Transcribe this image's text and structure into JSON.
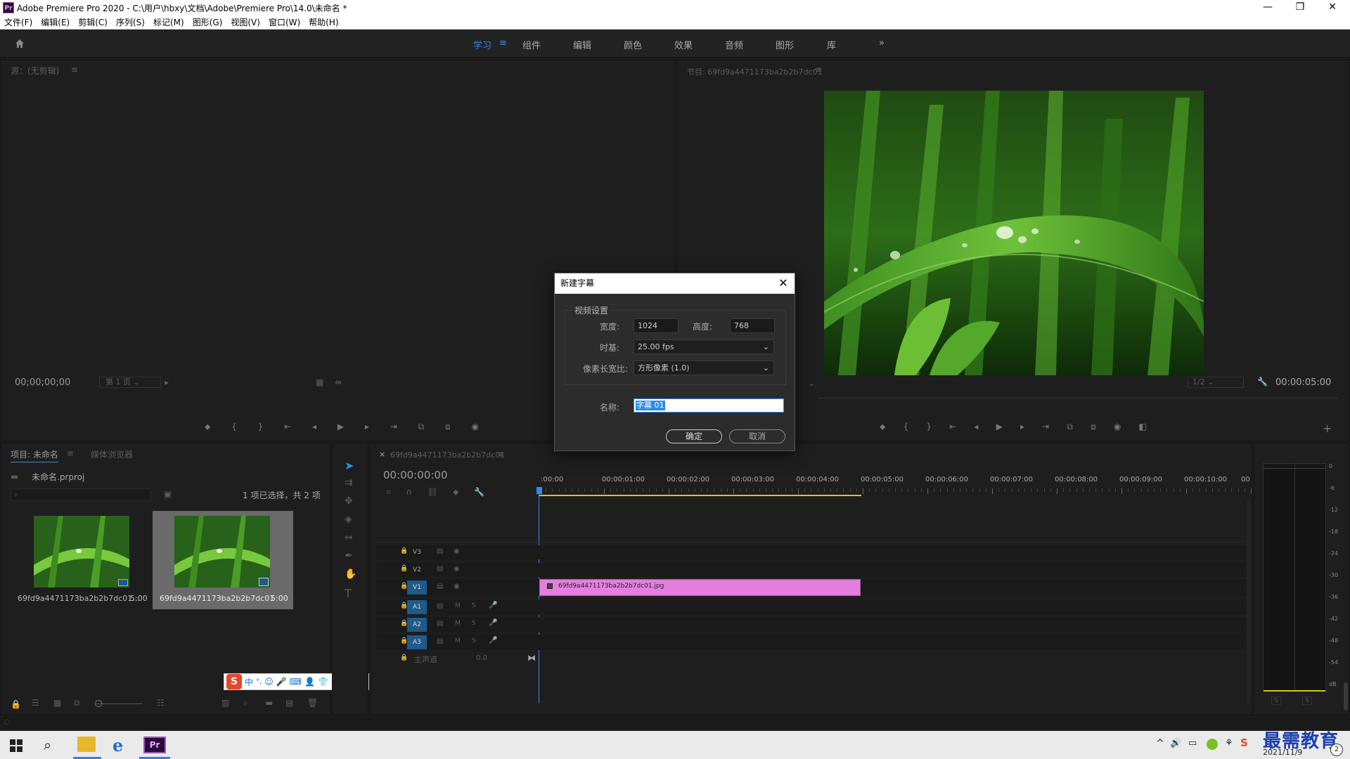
{
  "window": {
    "title": "Adobe Premiere Pro 2020 - C:\\用户\\hbxy\\文档\\Adobe\\Premiere Pro\\14.0\\未命名 *",
    "app_icon": "Pr",
    "controls": [
      "—",
      "❐",
      "✕"
    ]
  },
  "menu": [
    "文件(F)",
    "编辑(E)",
    "剪辑(C)",
    "序列(S)",
    "标记(M)",
    "图形(G)",
    "视图(V)",
    "窗口(W)",
    "帮助(H)"
  ],
  "workspaces": {
    "items": [
      "学习",
      "组件",
      "编辑",
      "颜色",
      "效果",
      "音频",
      "图形",
      "库"
    ],
    "active": "学习",
    "menu_glyph": "≡",
    "more_glyph": "»"
  },
  "source_monitor": {
    "title": "源：(无剪辑)",
    "timecode": "00;00;00;00",
    "page_select": "第 1 页"
  },
  "program_monitor": {
    "title": "节目: 69fd9a4471173ba2b2b7dc01",
    "timecode": "00:00:05:00",
    "zoom": "1/2"
  },
  "project_panel": {
    "tabs": [
      "项目: 未命名",
      "媒体浏览器"
    ],
    "project_file": "未命名.prproj",
    "selection_status": "1 项已选择，共 2 项",
    "items": [
      {
        "name": "69fd9a4471173ba2b2b7dc01...",
        "duration": "5:00"
      },
      {
        "name": "69fd9a4471173ba2b2b7dc01",
        "duration": "5:00"
      }
    ]
  },
  "timeline": {
    "sequence_name": "69fd9a4471173ba2b2b7dc01",
    "timecode": "00:00:00:00",
    "ruler": [
      ":00:00",
      "00:00:01:00",
      "00:00:02:00",
      "00:00:03:00",
      "00:00:04:00",
      "00:00:05:00",
      "00:00:06:00",
      "00:00:07:00",
      "00:00:08:00",
      "00:00:09:00",
      "00:00:10:00",
      "00"
    ],
    "video_tracks": [
      "V3",
      "V2",
      "V1"
    ],
    "audio_tracks": [
      "A1",
      "A2",
      "A3"
    ],
    "master": {
      "label": "主声道",
      "value": "0.0"
    },
    "clip": {
      "name": "69fd9a4471173ba2b2b7dc01.jpg",
      "color": "#e47fe0"
    },
    "audio_buttons": [
      "M",
      "S"
    ]
  },
  "audio_meter": {
    "scale": [
      "0",
      "-6",
      "-12",
      "-18",
      "-24",
      "-30",
      "-36",
      "-42",
      "-48",
      "-54",
      "dB"
    ],
    "solo": [
      "S",
      "S"
    ]
  },
  "dialog": {
    "title": "新建字幕",
    "group_label": "视频设置",
    "width_label": "宽度:",
    "width_value": "1024",
    "height_label": "高度:",
    "height_value": "768",
    "timebase_label": "时基:",
    "timebase_value": "25.00 fps",
    "par_label": "像素长宽比:",
    "par_value": "方形像素 (1.0)",
    "name_label": "名称:",
    "name_value": "字幕 01",
    "ok_label": "确定",
    "cancel_label": "取消"
  },
  "ime_toolbar": {
    "brand": "S",
    "lang": "中",
    "punct": "°,"
  },
  "taskbar": {
    "date": "2021/11/9",
    "watermark": "最需教育",
    "premiere_label": "Pr",
    "notification_count": "2"
  },
  "colors": {
    "accent": "#2d8ceb",
    "clip_pink": "#e47fe0",
    "track_active_blue": "#1e5a8a",
    "playhead": "#2d8ceb",
    "workarea_yellow": "#d8c81b"
  }
}
